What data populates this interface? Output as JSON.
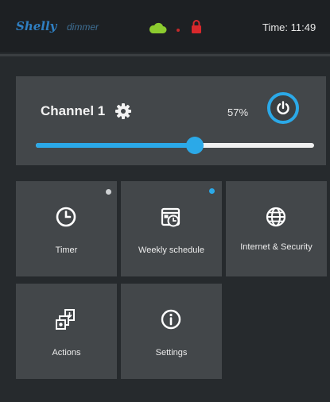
{
  "header": {
    "brand": "Shelly",
    "product": "dimmer",
    "time_text": "Time: 11:49"
  },
  "status_icons": [
    "cloud-icon",
    "lock-icon"
  ],
  "colors": {
    "accent": "#2ba9e8",
    "cloud": "#8ccb2f",
    "lock": "#d8282c",
    "brand": "#2f7fc2"
  },
  "channel": {
    "title": "Channel 1",
    "brightness_text": "57%",
    "brightness": 57
  },
  "tiles": [
    {
      "label": "Timer",
      "icon": "clock-icon",
      "indicator": "#cfd2d4"
    },
    {
      "label": "Weekly schedule",
      "icon": "calendar-icon",
      "indicator": "#2ba9e8"
    },
    {
      "label": "Internet & Security",
      "icon": "globe-icon"
    },
    {
      "label": "Actions",
      "icon": "actions-icon"
    },
    {
      "label": "Settings",
      "icon": "info-icon"
    }
  ]
}
